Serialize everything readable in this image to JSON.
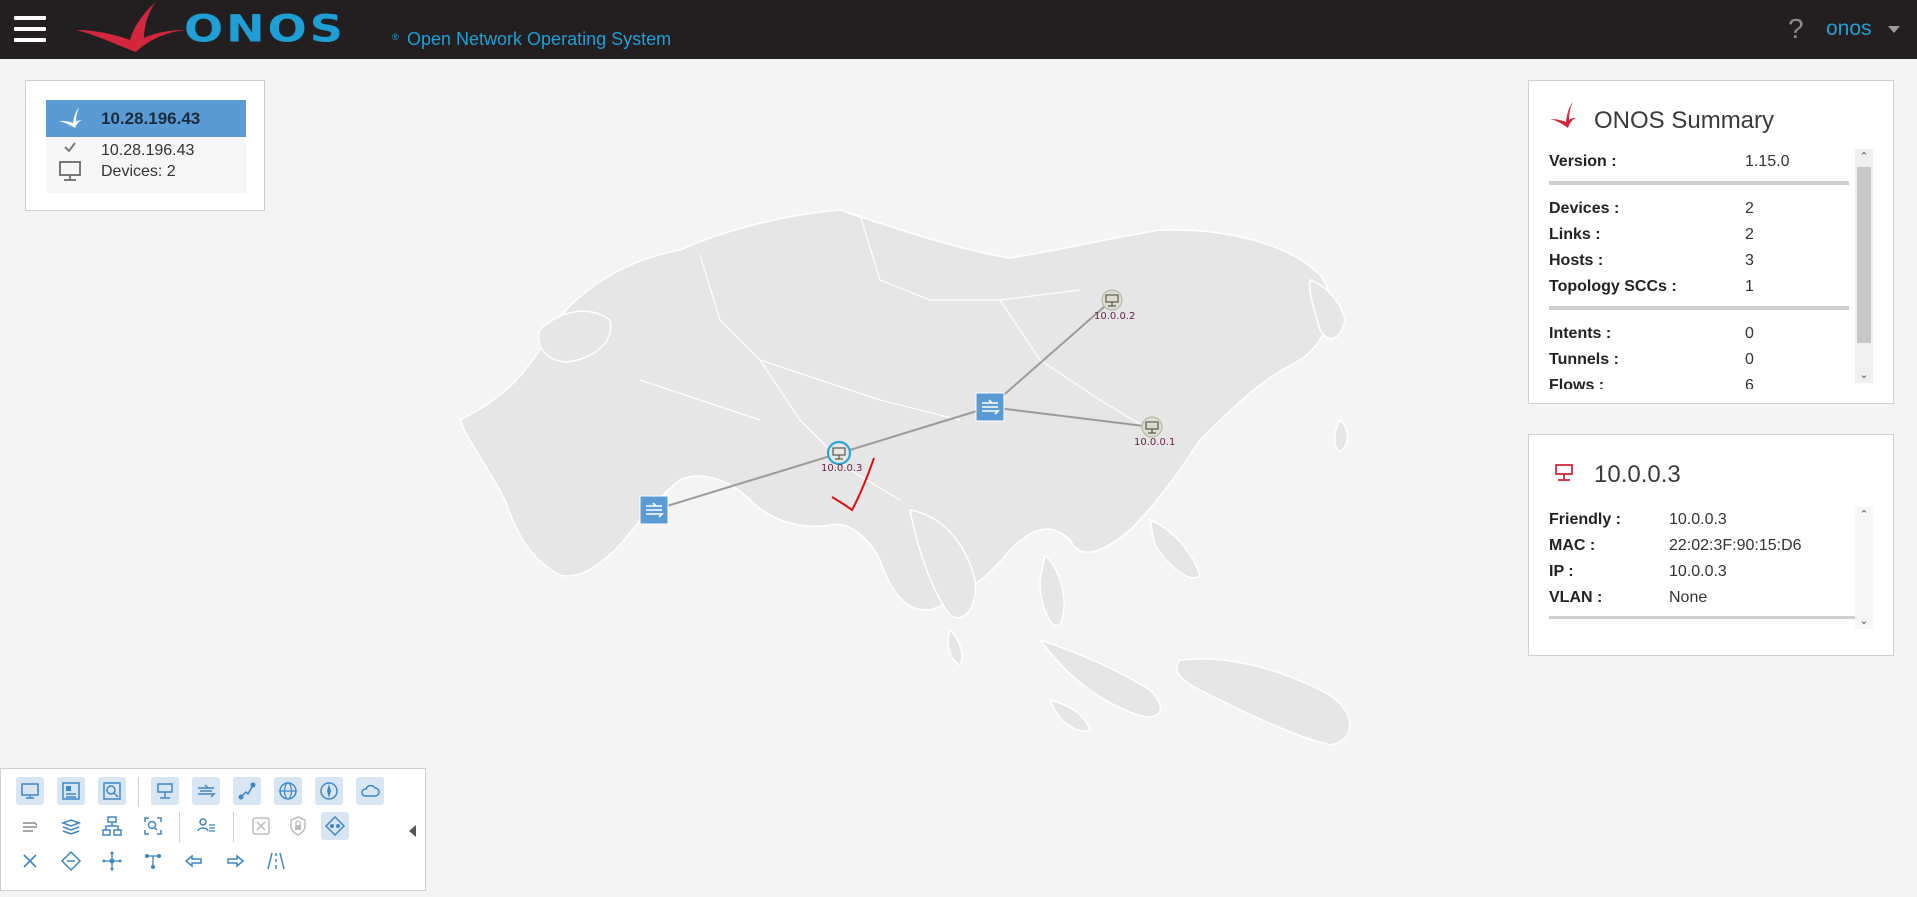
{
  "header": {
    "wordmark": "ONOS",
    "reg": "®",
    "subtitle": "Open Network Operating System",
    "help": "?",
    "user": "onos"
  },
  "instance_panel": {
    "title": "10.28.196.43",
    "ip": "10.28.196.43",
    "devices": "Devices: 2"
  },
  "summary": {
    "title": "ONOS Summary",
    "groups": [
      [
        {
          "k": "Version :",
          "v": "1.15.0"
        }
      ],
      [
        {
          "k": "Devices :",
          "v": "2"
        },
        {
          "k": "Links :",
          "v": "2"
        },
        {
          "k": "Hosts :",
          "v": "3"
        },
        {
          "k": "Topology SCCs :",
          "v": "1"
        }
      ],
      [
        {
          "k": "Intents :",
          "v": "0"
        },
        {
          "k": "Tunnels :",
          "v": "0"
        },
        {
          "k": "Flows :",
          "v": "6"
        }
      ]
    ]
  },
  "host_detail": {
    "title": "10.0.0.3",
    "rows": [
      {
        "k": "Friendly :",
        "v": "10.0.0.3"
      },
      {
        "k": "MAC :",
        "v": "22:02:3F:90:15:D6"
      },
      {
        "k": "IP :",
        "v": "10.0.0.3"
      },
      {
        "k": "VLAN :",
        "v": "None"
      }
    ]
  },
  "topology": {
    "hosts": [
      {
        "label": "10.0.0.2"
      },
      {
        "label": "10.0.0.1"
      },
      {
        "label": "10.0.0.3"
      }
    ]
  },
  "colors": {
    "header_bg": "#231f20",
    "accent": "#1e9fd6",
    "instance_head": "#5b9bd5",
    "host_label": "#6b1f45",
    "logo_red": "#d3273e"
  }
}
